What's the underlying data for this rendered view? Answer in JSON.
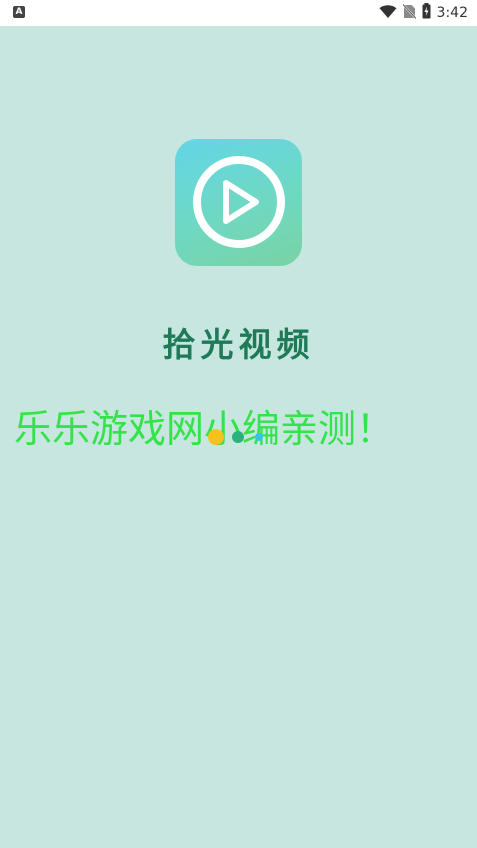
{
  "status_bar": {
    "left_icon": "A",
    "time": "3:42",
    "icons": [
      "wifi-icon",
      "no-sim-icon",
      "battery-charging-icon"
    ]
  },
  "splash": {
    "app_name": "拾光视频",
    "icon": "play-icon",
    "watermark": "乐乐游戏网小编亲测！"
  },
  "colors": {
    "background": "#c7e6df",
    "app_name": "#1f7a57",
    "watermark": "#34e34a",
    "loading_dots": [
      "#f6c21c",
      "#2bb27c",
      "#36c3e8"
    ]
  }
}
